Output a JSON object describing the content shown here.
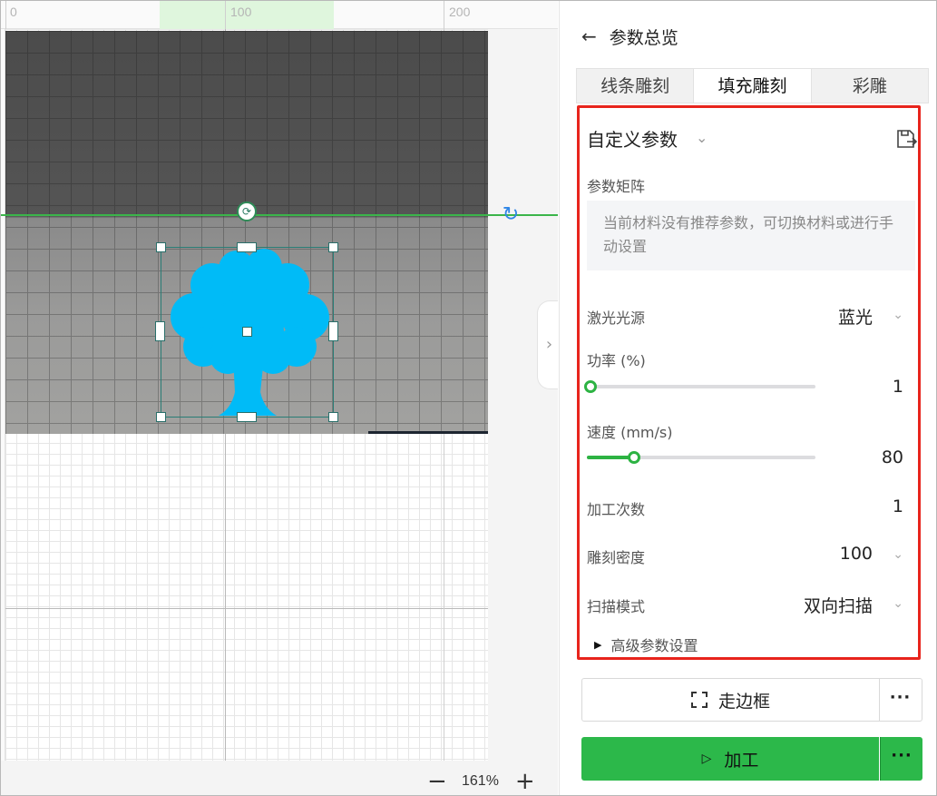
{
  "ruler": {
    "labels": [
      "0",
      "100",
      "200"
    ]
  },
  "zoom": {
    "minus": "−",
    "value": "161%",
    "plus": "+"
  },
  "panel": {
    "back_icon": "←",
    "title": "参数总览",
    "tabs": [
      {
        "label": "线条雕刻",
        "active": false
      },
      {
        "label": "填充雕刻",
        "active": true
      },
      {
        "label": "彩雕",
        "active": false
      }
    ],
    "preset": {
      "label": "自定义参数",
      "chevron": "⌄"
    },
    "matrix": {
      "label": "参数矩阵",
      "message": "当前材料没有推荐参数，可切换材料或进行手动设置"
    },
    "fields": {
      "laser_source": {
        "label": "激光光源",
        "value": "蓝光"
      },
      "power": {
        "label": "功率 (%)",
        "value": "1",
        "fraction": 0.0
      },
      "speed": {
        "label": "速度 (mm/s)",
        "value": "80",
        "fraction": 0.21
      },
      "passes": {
        "label": "加工次数",
        "value": "1"
      },
      "density": {
        "label": "雕刻密度",
        "value": "100"
      },
      "scan_mode": {
        "label": "扫描模式",
        "value": "双向扫描"
      }
    },
    "advanced": {
      "label": "高级参数设置"
    },
    "frame_button": {
      "label": "走边框",
      "more": "···"
    },
    "process_button": {
      "label": "加工",
      "more": "···"
    }
  },
  "colors": {
    "accent_green": "#2cb84a",
    "highlight_red": "#e8241c",
    "shape_fill": "#00bbf7"
  },
  "icons": {
    "back": "back-arrow-icon",
    "save": "save-export-icon",
    "rotate": "rotate-icon",
    "frame": "frame-dashed-square-icon",
    "play": "play-icon"
  }
}
